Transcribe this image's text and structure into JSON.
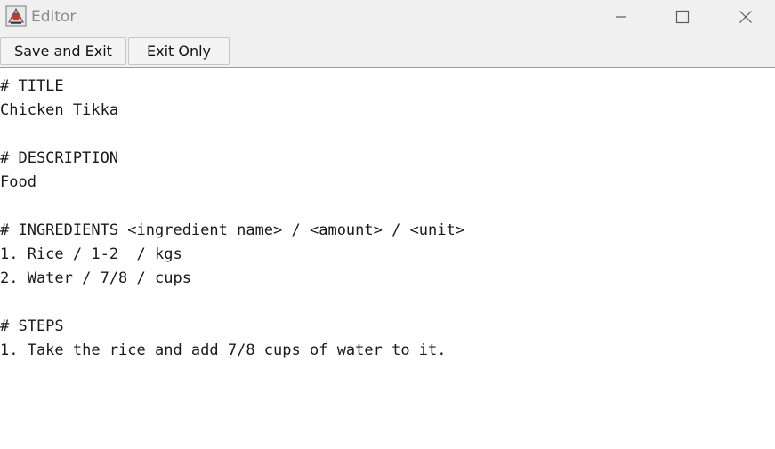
{
  "window": {
    "title": "Editor",
    "controls": {
      "minimize": "minimize-icon",
      "maximize": "maximize-icon",
      "close": "close-icon"
    }
  },
  "toolbar": {
    "save_label": "Save and Exit",
    "exit_label": "Exit Only"
  },
  "editor": {
    "lines": [
      "# TITLE",
      "Chicken Tikka",
      "",
      "# DESCRIPTION",
      "Food",
      "",
      "# INGREDIENTS <ingredient name> / <amount> / <unit>",
      "1. Rice / 1-2  / kgs",
      "2. Water / 7/8 / cups",
      "",
      "# STEPS",
      "1. Take the rice and add 7/8 cups of water to it."
    ]
  },
  "colors": {
    "titlebar_bg": "#f0f0f0",
    "title_text": "#8a8a8a",
    "text": "#1a1a1a"
  }
}
